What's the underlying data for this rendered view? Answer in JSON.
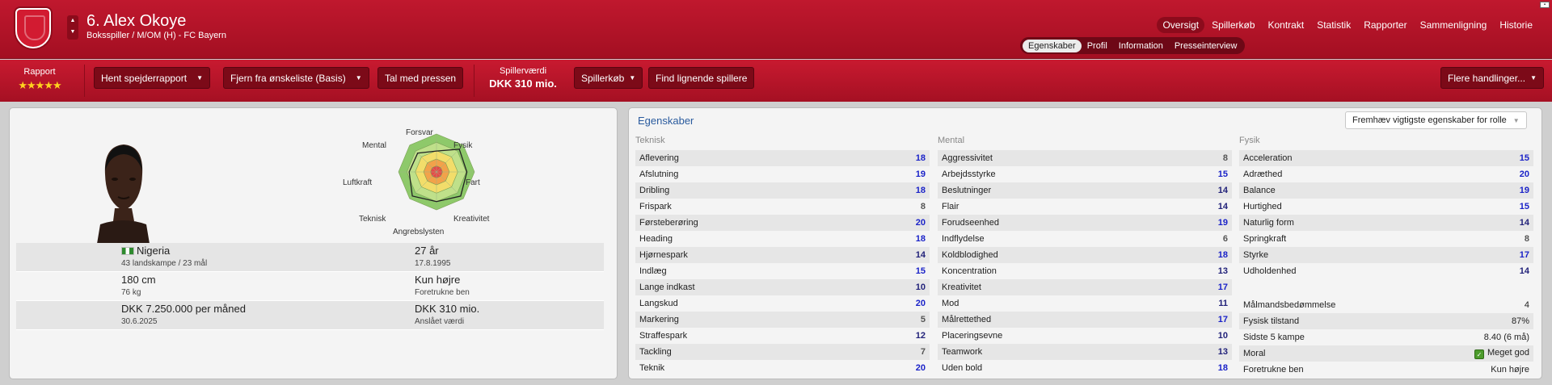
{
  "player": {
    "name": "6. Alex Okoye",
    "subtitle": "Boksspiller / M/OM (H) - FC Bayern"
  },
  "nav": {
    "items": [
      "Oversigt",
      "Spillerkøb",
      "Kontrakt",
      "Statistik",
      "Rapporter",
      "Sammenligning",
      "Historie"
    ],
    "active": "Oversigt"
  },
  "subnav": {
    "items": [
      "Egenskaber",
      "Profil",
      "Information",
      "Presseinterview"
    ],
    "active": "Egenskaber"
  },
  "toolbar": {
    "rapport_label": "Rapport",
    "rating_stars": 4.5,
    "stars_text": "★★★★★",
    "scout_btn": "Hent spejderrapport",
    "wishlist_btn": "Fjern fra ønskeliste (Basis)",
    "press_btn": "Tal med pressen",
    "value_label": "Spillerværdi",
    "value": "DKK 310 mio.",
    "buy_btn": "Spillerkøb",
    "similar_btn": "Find lignende spillere",
    "more_btn": "Flere handlinger..."
  },
  "radar": {
    "labels": [
      "Forsvar",
      "Fysik",
      "Fart",
      "Kreativitet",
      "Angrebslysten",
      "Teknisk",
      "Luftkraft",
      "Mental"
    ]
  },
  "info": {
    "nationality": "Nigeria",
    "caps": "43 landskampe / 23 mål",
    "age": "27 år",
    "dob": "17.8.1995",
    "height": "180 cm",
    "weight": "76 kg",
    "foot": "Kun højre",
    "foot_label": "Foretrukne ben",
    "wage": "DKK 7.250.000 per måned",
    "contract_end": "30.6.2025",
    "value": "DKK 310 mio.",
    "value_label": "Anslået værdi"
  },
  "attributes": {
    "title": "Egenskaber",
    "highlight_btn": "Fremhæv vigtigste egenskaber for rolle",
    "teknisk_header": "Teknisk",
    "mental_header": "Mental",
    "fysik_header": "Fysik",
    "teknisk": [
      [
        "Aflevering",
        "18"
      ],
      [
        "Afslutning",
        "19"
      ],
      [
        "Dribling",
        "18"
      ],
      [
        "Frispark",
        "8"
      ],
      [
        "Førsteberøring",
        "20"
      ],
      [
        "Heading",
        "18"
      ],
      [
        "Hjørnespark",
        "14"
      ],
      [
        "Indlæg",
        "15"
      ],
      [
        "Lange indkast",
        "10"
      ],
      [
        "Langskud",
        "20"
      ],
      [
        "Markering",
        "5"
      ],
      [
        "Straffespark",
        "12"
      ],
      [
        "Tackling",
        "7"
      ],
      [
        "Teknik",
        "20"
      ]
    ],
    "mental": [
      [
        "Aggressivitet",
        "8"
      ],
      [
        "Arbejdsstyrke",
        "15"
      ],
      [
        "Beslutninger",
        "14"
      ],
      [
        "Flair",
        "14"
      ],
      [
        "Forudseenhed",
        "19"
      ],
      [
        "Indflydelse",
        "6"
      ],
      [
        "Koldblodighed",
        "18"
      ],
      [
        "Koncentration",
        "13"
      ],
      [
        "Kreativitet",
        "17"
      ],
      [
        "Mod",
        "11"
      ],
      [
        "Målrettethed",
        "17"
      ],
      [
        "Placeringsevne",
        "10"
      ],
      [
        "Teamwork",
        "13"
      ],
      [
        "Uden bold",
        "18"
      ]
    ],
    "fysik": [
      [
        "Acceleration",
        "15"
      ],
      [
        "Adræthed",
        "20"
      ],
      [
        "Balance",
        "19"
      ],
      [
        "Hurtighed",
        "15"
      ],
      [
        "Naturlig form",
        "14"
      ],
      [
        "Springkraft",
        "8"
      ],
      [
        "Styrke",
        "17"
      ],
      [
        "Udholdenhed",
        "14"
      ]
    ],
    "extra": [
      [
        "Målmandsbedømmelse",
        "4"
      ],
      [
        "Fysisk tilstand",
        "87%"
      ],
      [
        "Sidste 5 kampe",
        "8.40 (6 må)"
      ],
      [
        "Moral",
        "Meget god"
      ],
      [
        "Foretrukne ben",
        "Kun højre"
      ]
    ]
  },
  "colors": {
    "high": "#1a22c8",
    "mid": "#22227a",
    "low": "#555555"
  }
}
